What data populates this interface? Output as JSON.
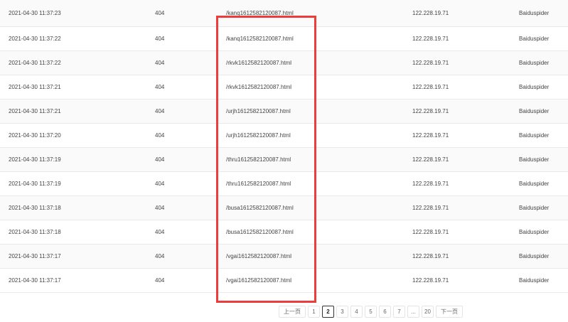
{
  "rows": [
    {
      "time": "2021-04-30 11:37:23",
      "code": "404",
      "path": "/kanq1612582120087.html",
      "ip": "122.228.19.71",
      "agent": "Baiduspider"
    },
    {
      "time": "2021-04-30 11:37:22",
      "code": "404",
      "path": "/kanq1612582120087.html",
      "ip": "122.228.19.71",
      "agent": "Baiduspider"
    },
    {
      "time": "2021-04-30 11:37:22",
      "code": "404",
      "path": "/rkvk1612582120087.html",
      "ip": "122.228.19.71",
      "agent": "Baiduspider"
    },
    {
      "time": "2021-04-30 11:37:21",
      "code": "404",
      "path": "/rkvk1612582120087.html",
      "ip": "122.228.19.71",
      "agent": "Baiduspider"
    },
    {
      "time": "2021-04-30 11:37:21",
      "code": "404",
      "path": "/urjh1612582120087.html",
      "ip": "122.228.19.71",
      "agent": "Baiduspider"
    },
    {
      "time": "2021-04-30 11:37:20",
      "code": "404",
      "path": "/urjh1612582120087.html",
      "ip": "122.228.19.71",
      "agent": "Baiduspider"
    },
    {
      "time": "2021-04-30 11:37:19",
      "code": "404",
      "path": "/thru1612582120087.html",
      "ip": "122.228.19.71",
      "agent": "Baiduspider"
    },
    {
      "time": "2021-04-30 11:37:19",
      "code": "404",
      "path": "/thru1612582120087.html",
      "ip": "122.228.19.71",
      "agent": "Baiduspider"
    },
    {
      "time": "2021-04-30 11:37:18",
      "code": "404",
      "path": "/busa1612582120087.html",
      "ip": "122.228.19.71",
      "agent": "Baiduspider"
    },
    {
      "time": "2021-04-30 11:37:18",
      "code": "404",
      "path": "/busa1612582120087.html",
      "ip": "122.228.19.71",
      "agent": "Baiduspider"
    },
    {
      "time": "2021-04-30 11:37:17",
      "code": "404",
      "path": "/vgai1612582120087.html",
      "ip": "122.228.19.71",
      "agent": "Baiduspider"
    },
    {
      "time": "2021-04-30 11:37:17",
      "code": "404",
      "path": "/vgai1612582120087.html",
      "ip": "122.228.19.71",
      "agent": "Baiduspider"
    }
  ],
  "pagination": {
    "prev_label": "上一页",
    "next_label": "下一页",
    "pages": [
      "1",
      "2",
      "3",
      "4",
      "5",
      "6",
      "7",
      "...",
      "20"
    ],
    "current": "2"
  },
  "colors": {
    "highlight": "#ee3b3b",
    "row_alt": "#fafafa",
    "border": "#e9e9e9"
  }
}
